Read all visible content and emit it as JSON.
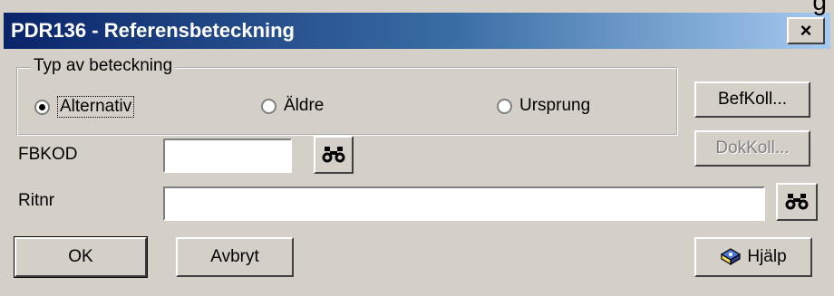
{
  "window": {
    "title": "PDR136 - Referensbeteckning",
    "close_label": "×",
    "corner_glyph": "g"
  },
  "group": {
    "legend": "Typ av beteckning",
    "options": [
      {
        "label": "Alternativ",
        "selected": true
      },
      {
        "label": "Äldre",
        "selected": false
      },
      {
        "label": "Ursprung",
        "selected": false
      }
    ]
  },
  "fields": {
    "fbkod_label": "FBKOD",
    "fbkod_value": "",
    "ritnr_label": "Ritnr",
    "ritnr_value": ""
  },
  "buttons": {
    "befkoll": "BefKoll...",
    "dokkoll": "DokKoll...",
    "ok": "OK",
    "avbryt": "Avbryt",
    "hjalp": "Hjälp"
  },
  "icons": [
    "binoculars-icon",
    "help-book-icon"
  ]
}
